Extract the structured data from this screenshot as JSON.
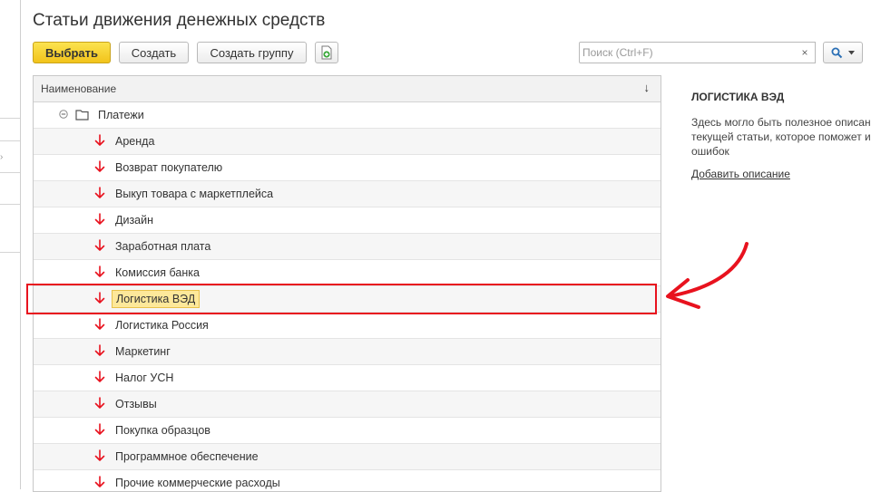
{
  "window": {
    "title": "Статьи движения денежных средств"
  },
  "toolbar": {
    "select_label": "Выбрать",
    "create_label": "Создать",
    "create_group_label": "Создать группу"
  },
  "search": {
    "placeholder": "Поиск (Ctrl+F)",
    "clear_glyph": "×"
  },
  "grid": {
    "column_header": "Наименование",
    "sort_glyph": "↓",
    "group": {
      "label": "Платежи",
      "expanded": true
    },
    "rows": [
      {
        "label": "Аренда"
      },
      {
        "label": "Возврат покупателю"
      },
      {
        "label": "Выкуп товара с маркетплейса"
      },
      {
        "label": "Дизайн"
      },
      {
        "label": "Заработная плата"
      },
      {
        "label": "Комиссия банка"
      },
      {
        "label": "Логистика ВЭД",
        "selected": true
      },
      {
        "label": "Логистика Россия"
      },
      {
        "label": "Маркетинг"
      },
      {
        "label": "Налог УСН"
      },
      {
        "label": "Отзывы"
      },
      {
        "label": "Покупка образцов"
      },
      {
        "label": "Программное обеспечение"
      },
      {
        "label": "Прочие коммерческие расходы"
      }
    ]
  },
  "side_panel": {
    "title": "ЛОГИСТИКА ВЭД",
    "description": "Здесь могло быть полезное описание\nтекущей статьи, которое поможет изб\nошибок",
    "add_description_link": "Добавить описание"
  },
  "colors": {
    "primary_button": "#f5c82a",
    "arrow_red": "#e8121e",
    "selection": "#fde89a",
    "callout_red": "#e8121e"
  },
  "icons": {
    "outflow": "red-down-arrow-icon",
    "group": "folder-icon",
    "collapse": "minus-circle-icon",
    "add_file": "green-plus-file-icon",
    "search": "magnifier-icon",
    "more": "vertical-dots-icon"
  }
}
